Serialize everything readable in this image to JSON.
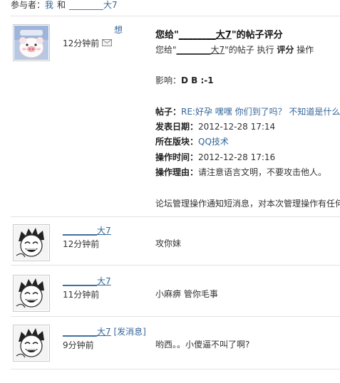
{
  "participants": {
    "label": "参与者：",
    "me": "我",
    "and": "和",
    "other_name": "________大7"
  },
  "notice": {
    "think_link": "想",
    "time": "12分钟前",
    "title_prefix": "您给\"",
    "title_name": "________大7",
    "title_suffix": "\"的帖子评分",
    "desc_prefix": "您给\"",
    "desc_name": "________大7",
    "desc_mid": "\"的帖子 执行 ",
    "desc_action": "评分",
    "desc_suffix": " 操作",
    "impact_label": "影响：",
    "impact_value": "D B :-1",
    "post_label": "帖子：",
    "post_value": "RE:好孕 嘿嘿   你们到了吗？ 不知道是什么",
    "date_label": "发表日期：",
    "date_value": "2012-12-28 17:14",
    "forum_label": "所在版块：",
    "forum_value": "QQ技术",
    "optime_label": "操作时间：",
    "optime_value": "2012-12-28 17:16",
    "reason_label": "操作理由：",
    "reason_value": "请注意语言文明，不要攻击他人。",
    "footer": "论坛管理操作通知短消息，对本次管理操作有任何"
  },
  "messages": [
    {
      "name": "________大7",
      "extra": "",
      "time": "12分钟前",
      "text": "攻你妹"
    },
    {
      "name": "________大7",
      "extra": "",
      "time": "11分钟前",
      "text": "小麻痹  管你毛事"
    },
    {
      "name": "________大7",
      "extra": " [发消息]",
      "time": "9分钟前",
      "text": "哟西。。小傻逼不叫了啊?"
    }
  ]
}
